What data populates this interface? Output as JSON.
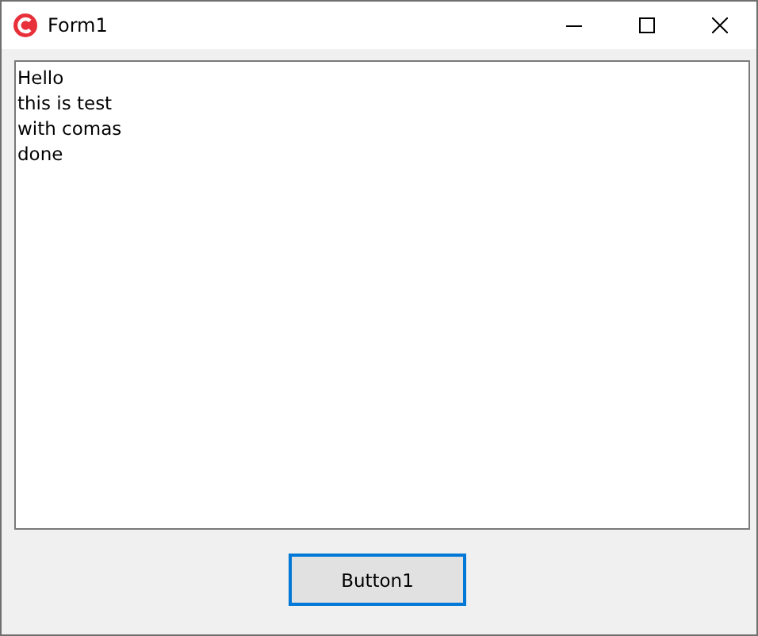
{
  "window": {
    "title": "Form1"
  },
  "textbox": {
    "lines": [
      "Hello",
      "this is test",
      "with comas",
      "done"
    ]
  },
  "button": {
    "label": "Button1",
    "focused": true
  }
}
